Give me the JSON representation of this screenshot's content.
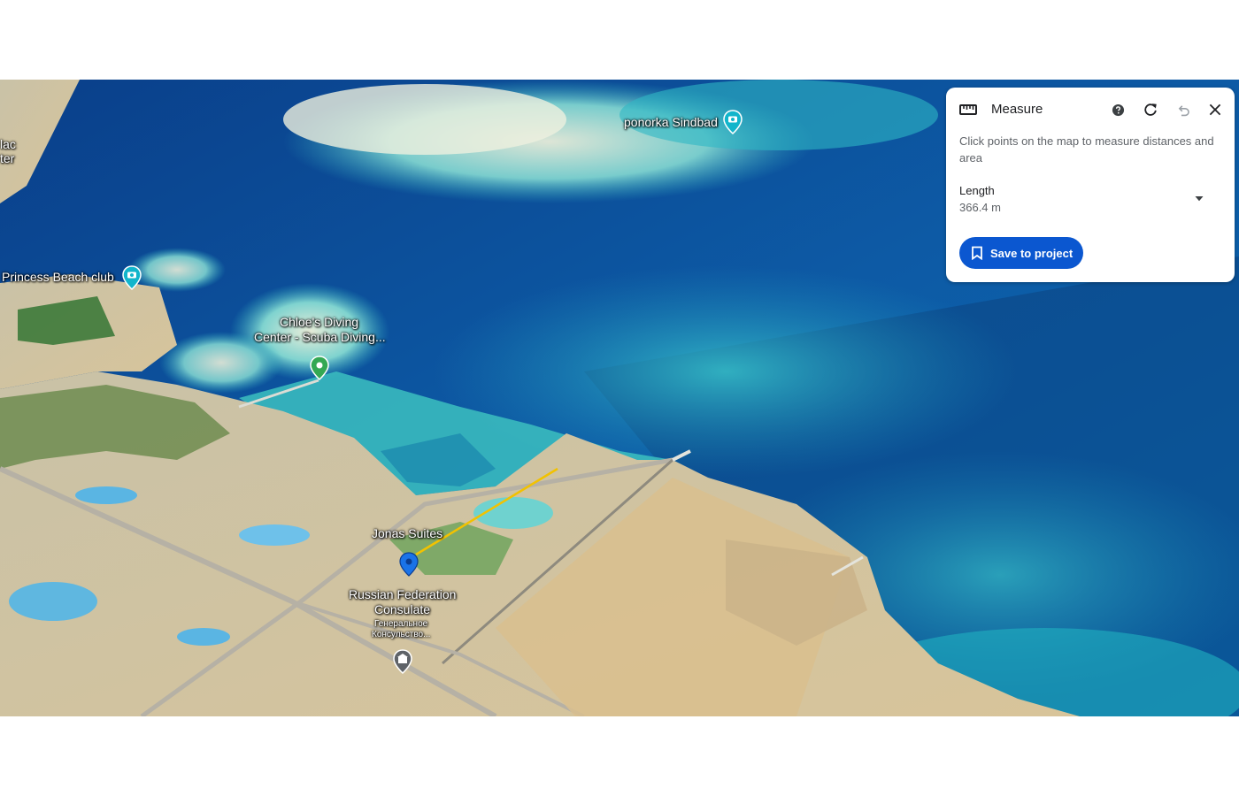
{
  "map": {
    "view": "satellite-3d",
    "labels": {
      "ponorka": "ponorka Sindbad",
      "princess": "Princess Beach club",
      "chloe_line1": "Chloe's Diving",
      "chloe_line2": "Center - Scuba Diving...",
      "jonas": "Jonas Suites",
      "russian_line1": "Russian Federation",
      "russian_line2": "Consulate",
      "russian_line3": "Генеральное",
      "russian_line4": "Консульство...",
      "edge_top": "lac",
      "edge_bottom": "ter"
    },
    "measure_line_color": "#f2c200",
    "pins": [
      {
        "name": "ponorka-sindbad",
        "icon": "camera-pin",
        "color": "#12b5cb"
      },
      {
        "name": "princess-beach-club",
        "icon": "camera-pin",
        "color": "#12b5cb"
      },
      {
        "name": "chloes-diving-center",
        "icon": "place-pin",
        "color": "#34a853"
      },
      {
        "name": "jonas-suites",
        "icon": "place-pin",
        "color": "#1a73e8"
      },
      {
        "name": "russian-consulate",
        "icon": "building-pin",
        "color": "#5f6368"
      }
    ]
  },
  "measure_panel": {
    "title": "Measure",
    "description": "Click points on the map to measure distances and area",
    "length_label": "Length",
    "length_value": "366.4 m",
    "save_label": "Save to project",
    "icons": {
      "title": "ruler-icon",
      "help": "help-icon",
      "refresh": "refresh-icon",
      "undo": "undo-icon",
      "close": "close-icon",
      "dropdown": "chevron-down-icon",
      "save": "bookmark-icon"
    },
    "accent": "#0b57d0"
  }
}
